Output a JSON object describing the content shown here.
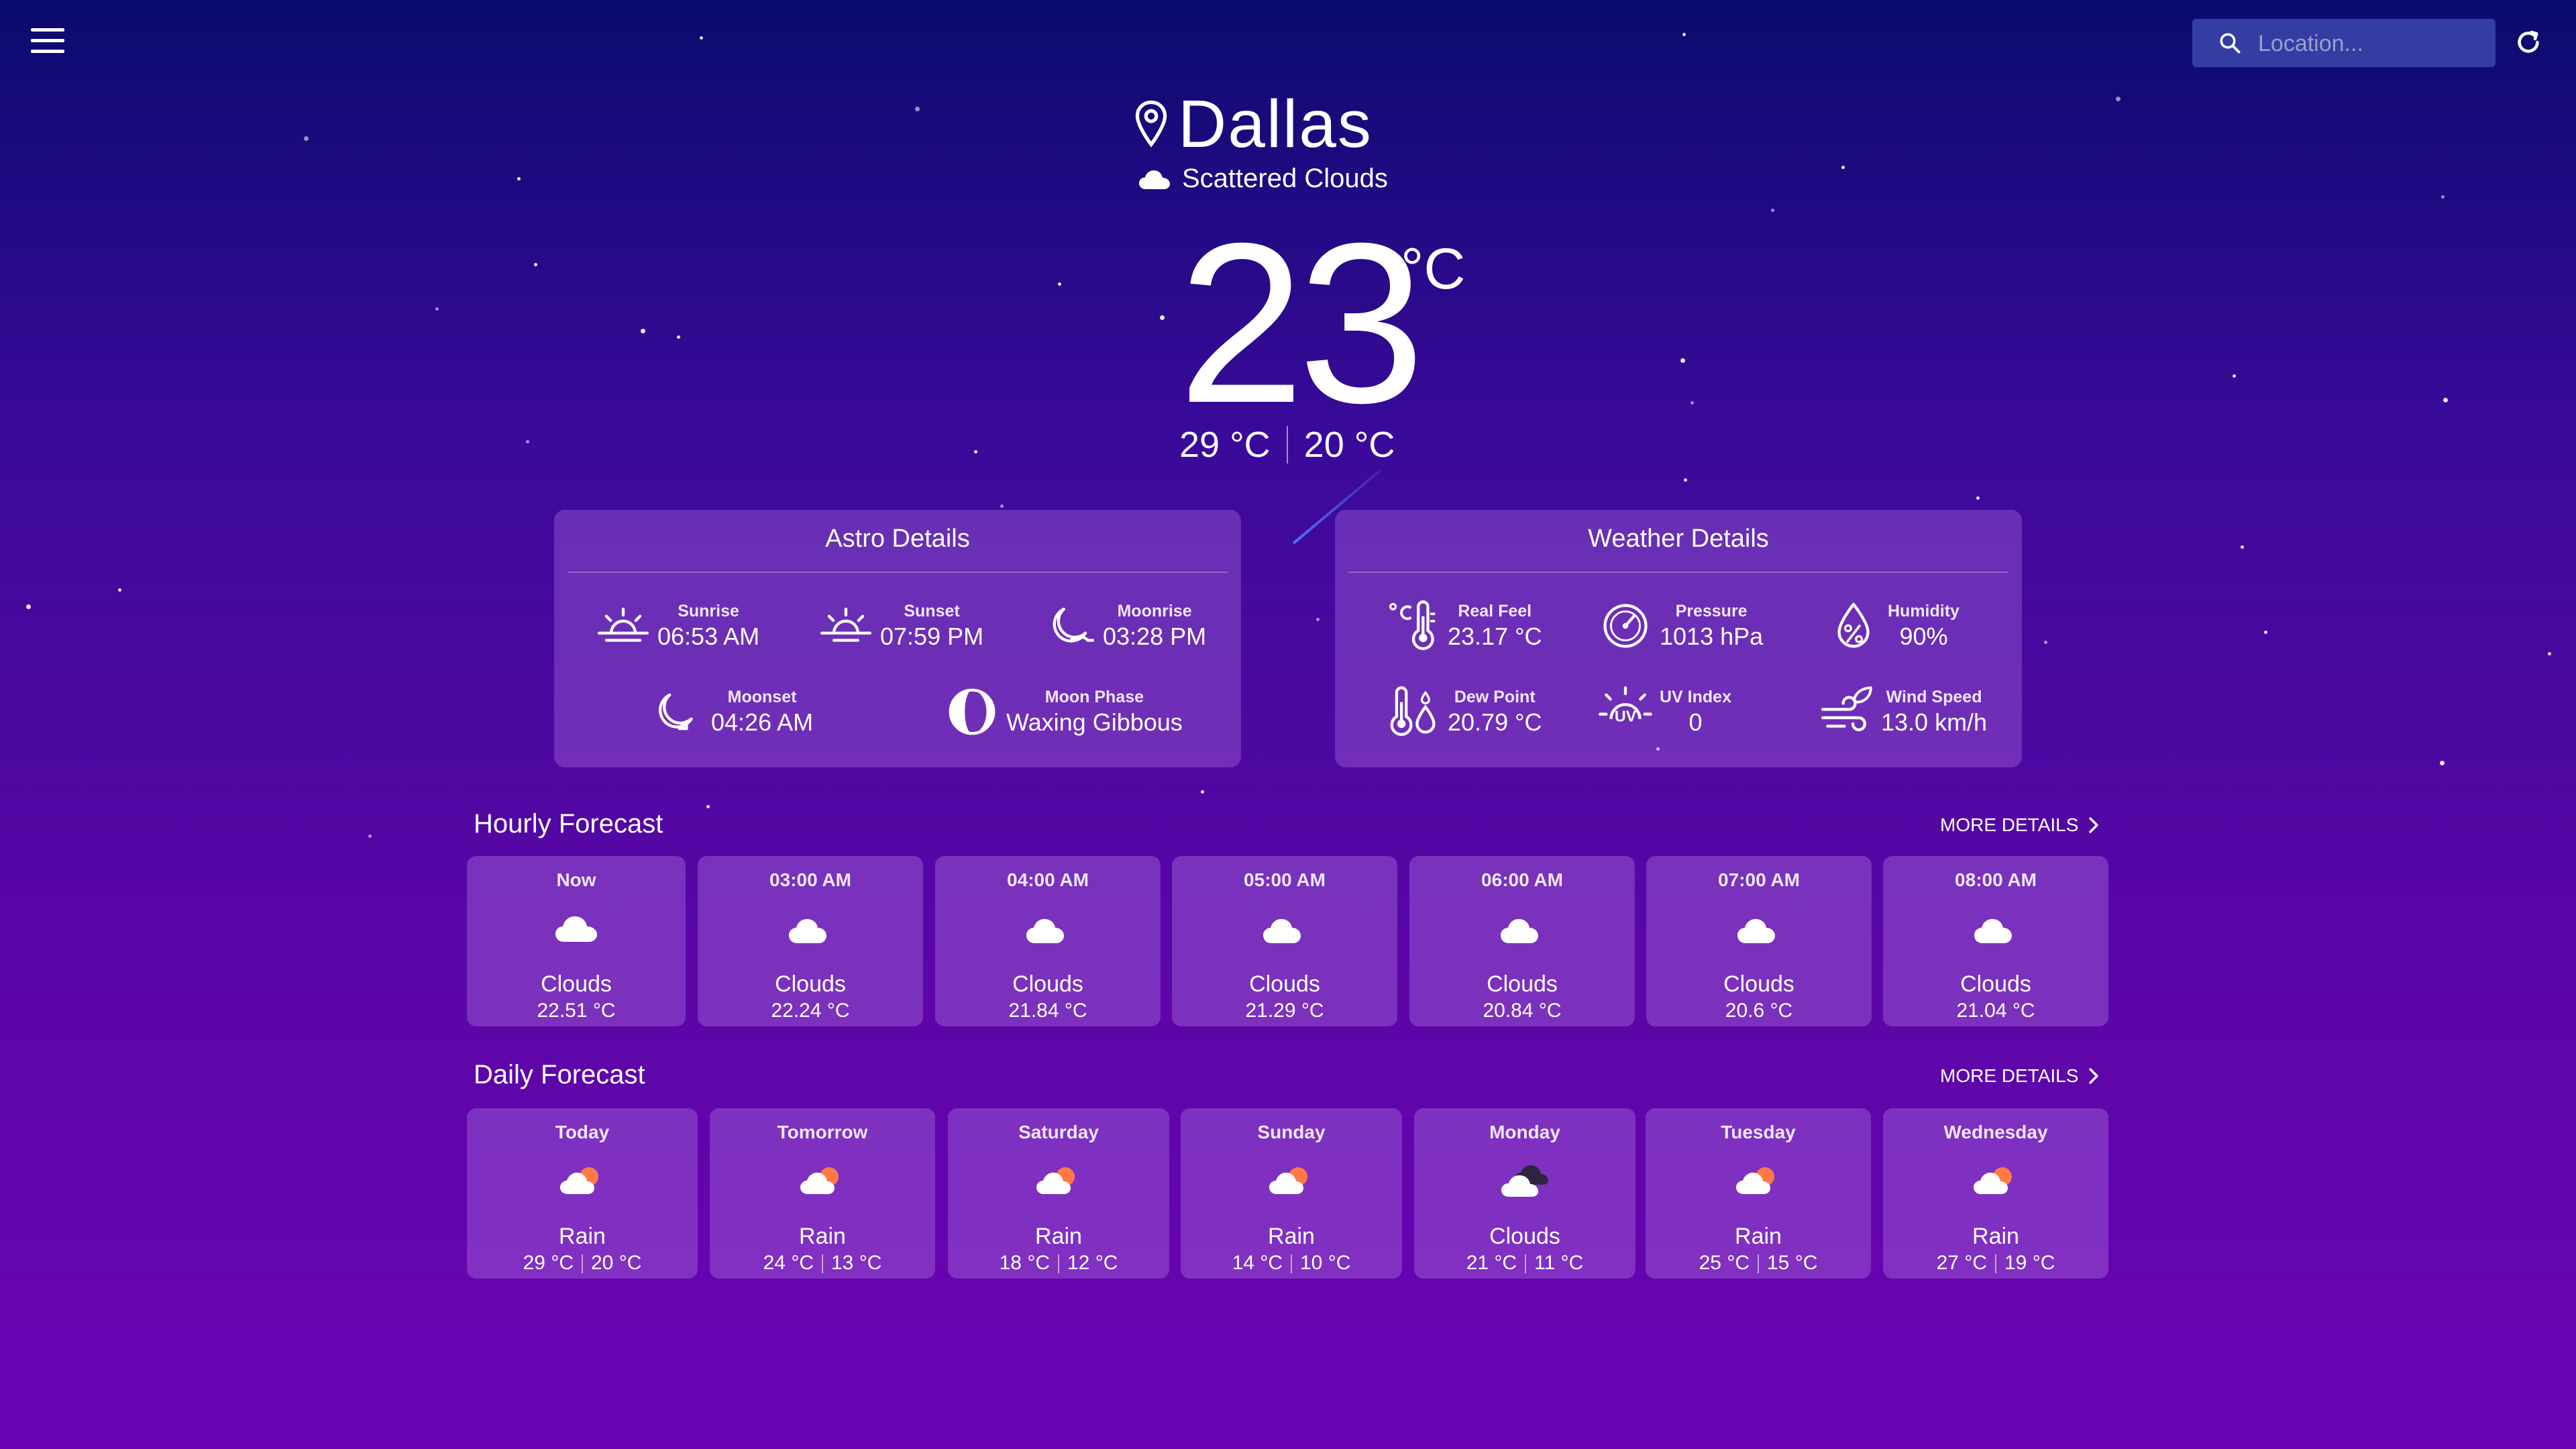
{
  "topbar": {
    "search_placeholder": "Location..."
  },
  "current": {
    "city": "Dallas",
    "condition": "Scattered Clouds",
    "temp": "23",
    "unit": "°C",
    "high": "29 °C",
    "low": "20 °C"
  },
  "astro": {
    "title": "Astro Details",
    "sunrise": {
      "label": "Sunrise",
      "value": "06:53 AM"
    },
    "sunset": {
      "label": "Sunset",
      "value": "07:59 PM"
    },
    "moonrise": {
      "label": "Moonrise",
      "value": "03:28 PM"
    },
    "moonset": {
      "label": "Moonset",
      "value": "04:26 AM"
    },
    "moonphase": {
      "label": "Moon Phase",
      "value": "Waxing Gibbous"
    }
  },
  "weather": {
    "title": "Weather Details",
    "realfeel": {
      "label": "Real Feel",
      "value": "23.17 °C"
    },
    "pressure": {
      "label": "Pressure",
      "value": "1013 hPa"
    },
    "humidity": {
      "label": "Humidity",
      "value": "90%"
    },
    "dewpoint": {
      "label": "Dew Point",
      "value": "20.79 °C"
    },
    "uv": {
      "label": "UV Index",
      "value": "0"
    },
    "wind": {
      "label": "Wind Speed",
      "value": "13.0 km/h"
    }
  },
  "hourly": {
    "title": "Hourly Forecast",
    "more": "MORE DETAILS",
    "items": [
      {
        "time": "Now",
        "desc": "Clouds",
        "temp": "22.51 °C",
        "icon": "cloud-icon"
      },
      {
        "time": "03:00 AM",
        "desc": "Clouds",
        "temp": "22.24 °C",
        "icon": "night-cloud-icon"
      },
      {
        "time": "04:00 AM",
        "desc": "Clouds",
        "temp": "21.84 °C",
        "icon": "night-cloud-icon"
      },
      {
        "time": "05:00 AM",
        "desc": "Clouds",
        "temp": "21.29 °C",
        "icon": "night-cloud-icon"
      },
      {
        "time": "06:00 AM",
        "desc": "Clouds",
        "temp": "20.84 °C",
        "icon": "night-cloud-icon"
      },
      {
        "time": "07:00 AM",
        "desc": "Clouds",
        "temp": "20.6 °C",
        "icon": "night-cloud-icon"
      },
      {
        "time": "08:00 AM",
        "desc": "Clouds",
        "temp": "21.04 °C",
        "icon": "night-cloud-icon"
      }
    ]
  },
  "daily": {
    "title": "Daily Forecast",
    "more": "MORE DETAILS",
    "items": [
      {
        "day": "Today",
        "desc": "Rain",
        "high": "29 °C",
        "low": "20 °C",
        "icon": "sun-cloud-icon"
      },
      {
        "day": "Tomorrow",
        "desc": "Rain",
        "high": "24 °C",
        "low": "13 °C",
        "icon": "sun-cloud-icon"
      },
      {
        "day": "Saturday",
        "desc": "Rain",
        "high": "18 °C",
        "low": "12 °C",
        "icon": "sun-cloud-icon"
      },
      {
        "day": "Sunday",
        "desc": "Rain",
        "high": "14 °C",
        "low": "10 °C",
        "icon": "sun-cloud-icon"
      },
      {
        "day": "Monday",
        "desc": "Clouds",
        "high": "21 °C",
        "low": "11 °C",
        "icon": "dark-clouds-icon"
      },
      {
        "day": "Tuesday",
        "desc": "Rain",
        "high": "25 °C",
        "low": "15 °C",
        "icon": "sun-cloud-icon"
      },
      {
        "day": "Wednesday",
        "desc": "Rain",
        "high": "27 °C",
        "low": "19 °C",
        "icon": "sun-cloud-icon"
      }
    ]
  },
  "colors": {
    "bg_top": "#0a0b6e",
    "bg_bottom": "#6a04b4",
    "panel": "#9a5cd0",
    "sun_orange": "#ff7a45"
  }
}
